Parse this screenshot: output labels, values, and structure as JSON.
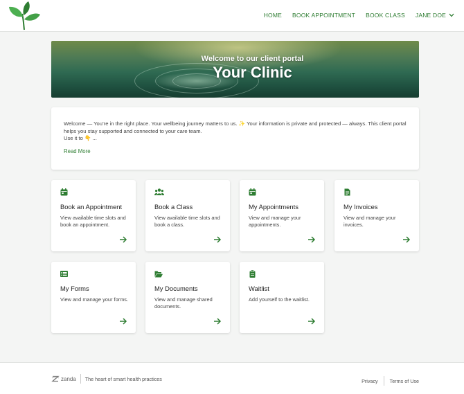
{
  "colors": {
    "accent": "#2e7d32",
    "background": "#f4f5f4"
  },
  "nav": {
    "items": [
      {
        "label": "HOME"
      },
      {
        "label": "BOOK APPOINTMENT"
      },
      {
        "label": "BOOK CLASS"
      }
    ],
    "user_label": "JANE DOE"
  },
  "hero": {
    "subtitle": "Welcome to our client portal",
    "title": "Your Clinic"
  },
  "welcome": {
    "text1": "Welcome — You’re in the right place. Your wellbeing journey matters to us. ✨ Your information is private and protected — always. This client portal helps you stay supported and connected to your care team.",
    "text2": "Use it to 👇 ...",
    "read_more": "Read More"
  },
  "cards": [
    {
      "icon": "calendar-icon",
      "title": "Book an Appointment",
      "desc": "View available time slots and book an appointment."
    },
    {
      "icon": "users-icon",
      "title": "Book a Class",
      "desc": "View available time slots and book a class."
    },
    {
      "icon": "calendar-icon",
      "title": "My Appointments",
      "desc": "View and manage your appointments."
    },
    {
      "icon": "invoice-icon",
      "title": "My Invoices",
      "desc": "View and manage your invoices."
    },
    {
      "icon": "list-icon",
      "title": "My Forms",
      "desc": "View and manage your forms."
    },
    {
      "icon": "folder-icon",
      "title": "My Documents",
      "desc": "View and manage shared documents."
    },
    {
      "icon": "clipboard-icon",
      "title": "Waitlist",
      "desc": "Add yourself to the waitlist."
    }
  ],
  "footer": {
    "brand": "zanda",
    "tagline": "The heart of smart health practices",
    "privacy": "Privacy",
    "terms": "Terms of Use"
  }
}
